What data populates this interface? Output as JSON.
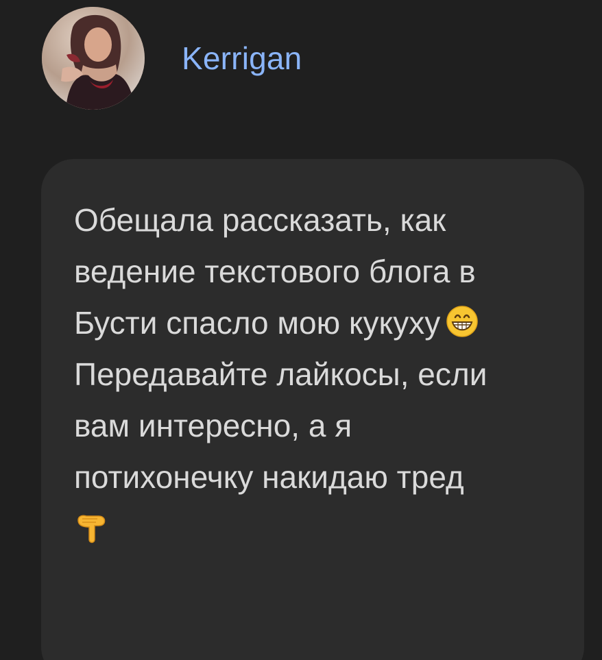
{
  "post": {
    "author": {
      "name": "Kerrigan",
      "avatar_icon": "user-avatar-photo"
    },
    "message": {
      "lines": [
        "Обещала рассказать, как",
        "ведение текстового блога в",
        "Бусти спасло мою кукуху",
        "Передавайте лайкосы, если",
        "вам интересно, а я",
        "потихонечку накидаю тред"
      ],
      "emojis": {
        "after_line_3": "grinning-face-emoji",
        "final": "backhand-pointing-down-emoji"
      }
    }
  },
  "colors": {
    "background": "#1f1f1f",
    "bubble": "#2c2c2c",
    "username": "#8ab4f8",
    "text": "#dadada"
  }
}
